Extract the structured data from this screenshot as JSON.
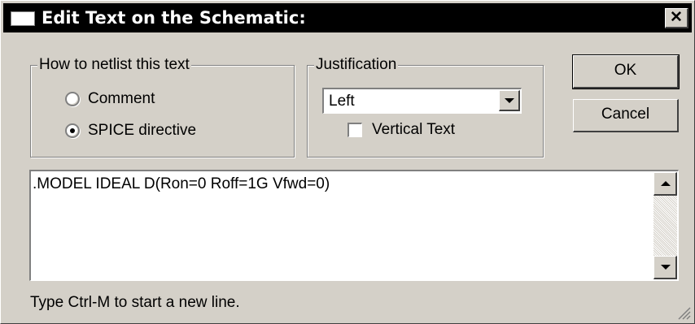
{
  "window": {
    "title": "Edit Text on the Schematic:",
    "close_label": "✕"
  },
  "netlist_group": {
    "legend": "How to netlist this text",
    "options": [
      {
        "label": "Comment",
        "selected": false
      },
      {
        "label": "SPICE directive",
        "selected": true
      }
    ]
  },
  "justification_group": {
    "legend": "Justification",
    "selected_value": "Left",
    "vertical_text_label": "Vertical Text",
    "vertical_text_checked": false
  },
  "buttons": {
    "ok_label": "OK",
    "cancel_label": "Cancel"
  },
  "editor": {
    "text": ".MODEL IDEAL D(Ron=0 Roff=1G Vfwd=0)"
  },
  "status": {
    "hint": "Type Ctrl-M to start a new line."
  },
  "icons": {
    "system": "window-icon",
    "close": "close-icon",
    "dropdown": "chevron-down-icon",
    "scroll_up": "arrow-up-icon",
    "scroll_down": "arrow-down-icon",
    "resize": "resize-grip-icon"
  },
  "colors": {
    "dialog_face": "#d4d0c8",
    "titlebar": "#000000",
    "title_text": "#ffffff",
    "field_bg": "#ffffff"
  }
}
